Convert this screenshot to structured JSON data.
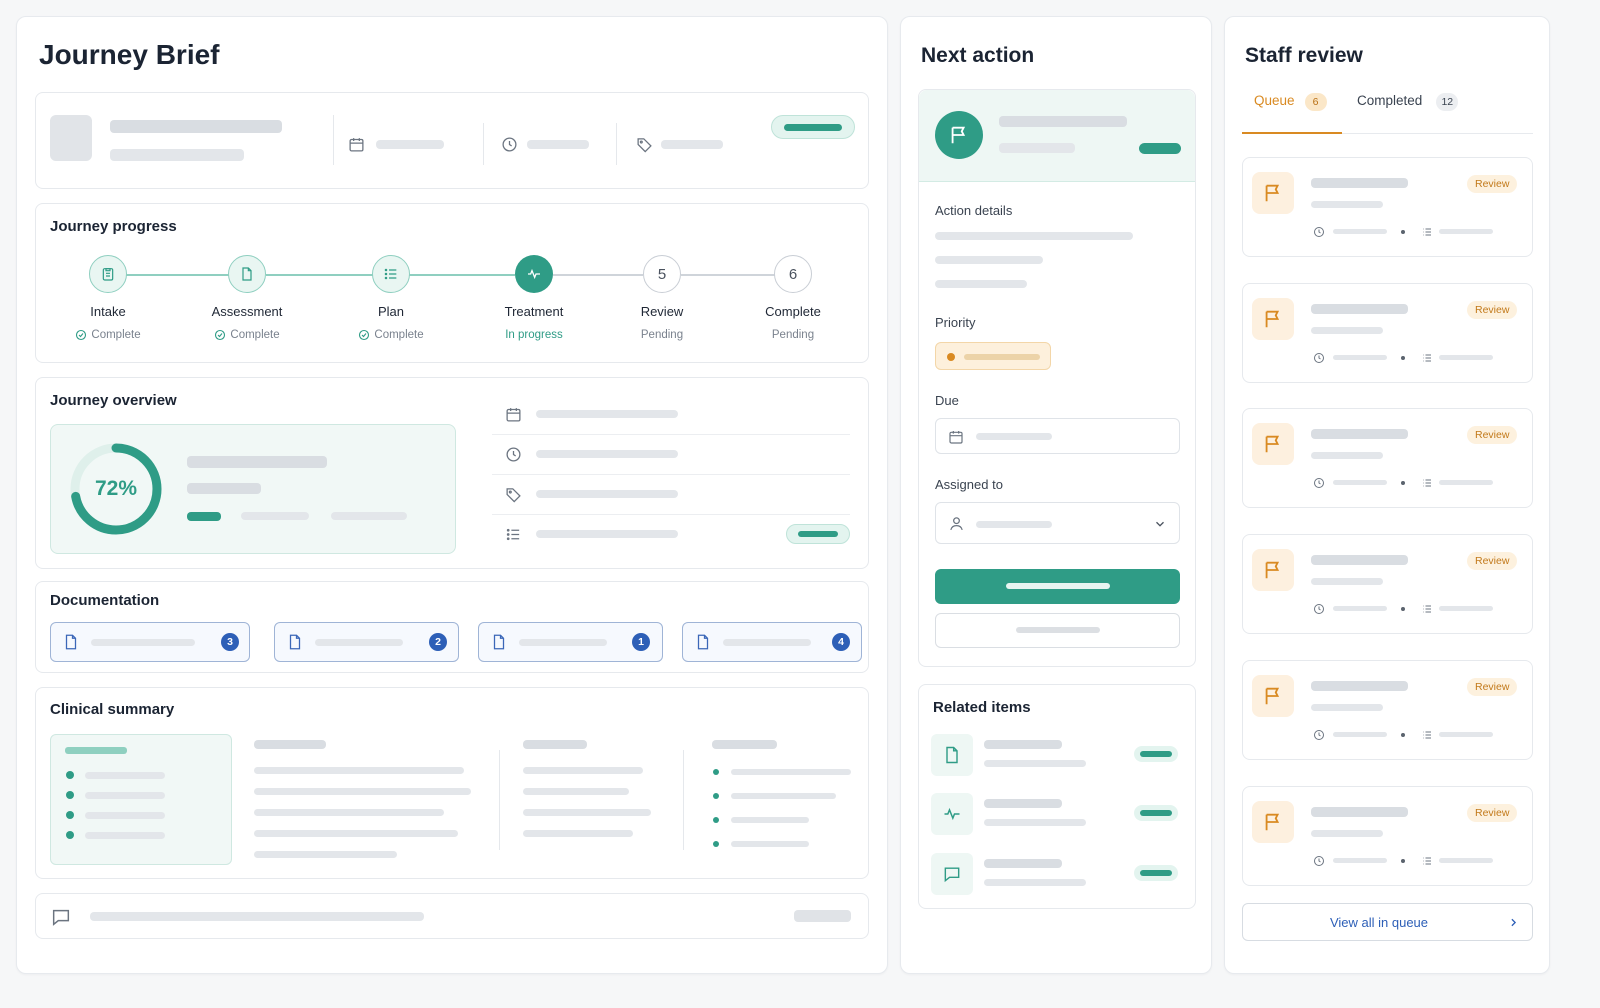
{
  "brief": {
    "title": "Journey Brief",
    "progress_title": "Journey progress",
    "steps": [
      {
        "name": "Intake",
        "status": "Complete",
        "icon": "clipboard-icon"
      },
      {
        "name": "Assessment",
        "status": "Complete",
        "icon": "document-icon"
      },
      {
        "name": "Plan",
        "status": "Complete",
        "icon": "list-icon"
      },
      {
        "name": "Treatment",
        "status": "In progress",
        "icon": "activity-icon"
      },
      {
        "name": "Review",
        "status": "Pending",
        "number": "5"
      },
      {
        "name": "Complete",
        "status": "Pending",
        "number": "6"
      }
    ],
    "overview_title": "Journey overview",
    "overview_percent": "72%",
    "overview_progress": 0.72,
    "documentation_title": "Documentation",
    "doc_counts": [
      "3",
      "2",
      "1",
      "4"
    ],
    "clinical_title": "Clinical summary"
  },
  "next_action": {
    "title": "Next action",
    "details_label": "Action details",
    "priority_label": "Priority",
    "due_label": "Due",
    "assigned_label": "Assigned to",
    "related_title": "Related items"
  },
  "staff_review": {
    "title": "Staff review",
    "tab_queue": "Queue",
    "queue_count": "6",
    "tab_completed": "Completed",
    "completed_count": "12",
    "review_badge": "Review",
    "view_all": "View all in queue"
  },
  "colors": {
    "accent": "#2f9c86",
    "warn": "#d98a22",
    "doc_blue": "#2d5fb7"
  }
}
